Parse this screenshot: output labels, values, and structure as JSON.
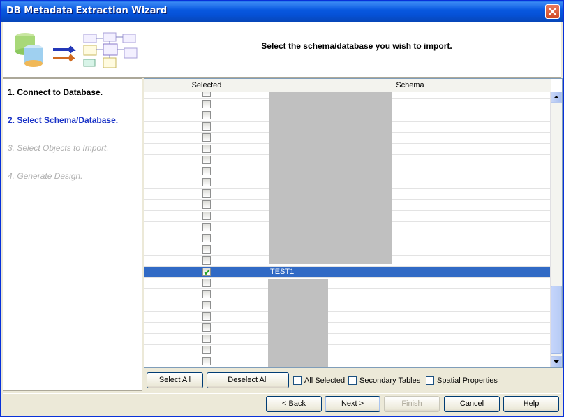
{
  "window": {
    "title": "DB Metadata Extraction Wizard"
  },
  "banner": {
    "heading": "Select the schema/database you wish to import."
  },
  "steps": [
    {
      "label": "1. Connect to Database.",
      "state": "done"
    },
    {
      "label": "2. Select Schema/Database.",
      "state": "current"
    },
    {
      "label": "3. Select Objects to Import.",
      "state": "future"
    },
    {
      "label": "4. Generate Design.",
      "state": "future"
    }
  ],
  "grid": {
    "columns": {
      "selected": "Selected",
      "schema": "Schema"
    },
    "selected_row": {
      "schema": "TEST1",
      "checked": true
    }
  },
  "buttons": {
    "select_all": "Select All",
    "deselect_all": "Deselect All",
    "back": "< Back",
    "next": "Next >",
    "finish": "Finish",
    "cancel": "Cancel",
    "help": "Help"
  },
  "options": {
    "all_selected": "All Selected",
    "secondary_tables": "Secondary Tables",
    "spatial_properties": "Spatial Properties"
  },
  "colors": {
    "title_bar": "#0858e0",
    "selection": "#316ac5",
    "current_step": "#1a33c7"
  }
}
